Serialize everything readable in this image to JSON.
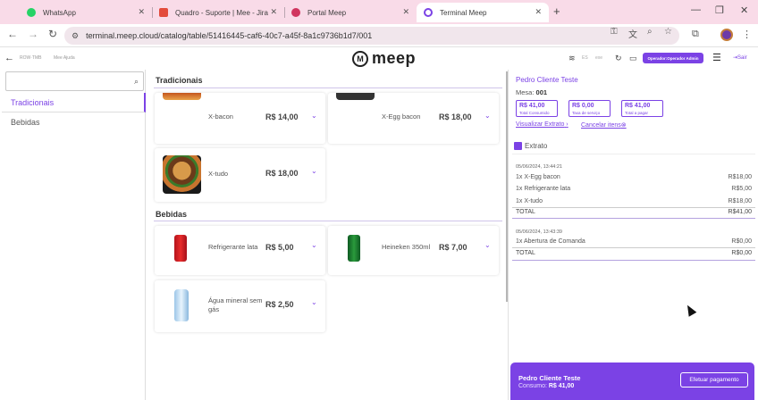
{
  "browser": {
    "tabs": [
      {
        "title": "WhatsApp",
        "icon": "whatsapp-icon",
        "color": "#25d366"
      },
      {
        "title": "Quadro - Suporte | Mee - Jira",
        "icon": "jira-icon",
        "color": "#e34b3c"
      },
      {
        "title": "Portal Meep",
        "icon": "meep-icon",
        "color": "#d0345e"
      },
      {
        "title": "Terminal Meep",
        "icon": "meep-icon",
        "color": "#7b42e5"
      }
    ],
    "url": "terminal.meep.cloud/catalog/table/51416445-caf6-40c7-a45f-8a1c9736b1d7/001"
  },
  "header": {
    "left_small_1": "ROW·TMB",
    "left_small_2": "Mee Ajuda",
    "logo_text": "meep",
    "status_1": "ES",
    "status_2": "exe",
    "operator_button": "Operador:Operador Admin",
    "exit_label": "Sair"
  },
  "sidebar": {
    "search_placeholder": "",
    "categories": [
      {
        "label": "Tradicionais",
        "active": true
      },
      {
        "label": "Bebidas",
        "active": false
      }
    ]
  },
  "catalog": {
    "sections": [
      {
        "title": "Tradicionais",
        "products": [
          {
            "name": "X-bacon",
            "price": "R$ 14,00"
          },
          {
            "name": "X-Egg bacon",
            "price": "R$ 18,00"
          },
          {
            "name": "X-tudo",
            "price": "R$ 18,00"
          }
        ]
      },
      {
        "title": "Bebidas",
        "products": [
          {
            "name": "Refrigerante lata",
            "price": "R$ 5,00"
          },
          {
            "name": "Heineken 350ml",
            "price": "R$ 7,00"
          },
          {
            "name": "Água mineral sem gás",
            "price": "R$ 2,50"
          }
        ]
      }
    ]
  },
  "panel": {
    "client_name": "Pedro Cliente Teste",
    "table_label": "Mesa:",
    "table_number": "001",
    "summary": [
      {
        "value": "R$ 41,00",
        "label": "Total Consumido"
      },
      {
        "value": "R$ 0,00",
        "label": "Taxa de serviço"
      },
      {
        "value": "R$ 41,00",
        "label": "Total a pagar"
      }
    ],
    "view_statement": "Visualizar Extrato",
    "cancel_items": "Cancelar itens",
    "statement_title": "Extrato",
    "statements": [
      {
        "datetime": "05/06/2024, 13:44:21",
        "items": [
          {
            "desc": "1x X-Egg bacon",
            "value": "R$18,00"
          },
          {
            "desc": "1x Refrigerante lata",
            "value": "R$5,00"
          },
          {
            "desc": "1x X-tudo",
            "value": "R$18,00"
          }
        ],
        "total_label": "TOTAL",
        "total_value": "R$41,00"
      },
      {
        "datetime": "05/06/2024, 13:43:39",
        "items": [
          {
            "desc": "1x Abertura de Comanda",
            "value": "R$0,00"
          }
        ],
        "total_label": "TOTAL",
        "total_value": "R$0,00"
      }
    ]
  },
  "footer": {
    "client_name": "Pedro Cliente Teste",
    "consumption_label": "Consumo:",
    "consumption_value": "R$ 41,00",
    "pay_button": "Efetuar pagamento"
  },
  "colors": {
    "accent": "#7b42e5",
    "tabbar": "#f9dbe8"
  }
}
